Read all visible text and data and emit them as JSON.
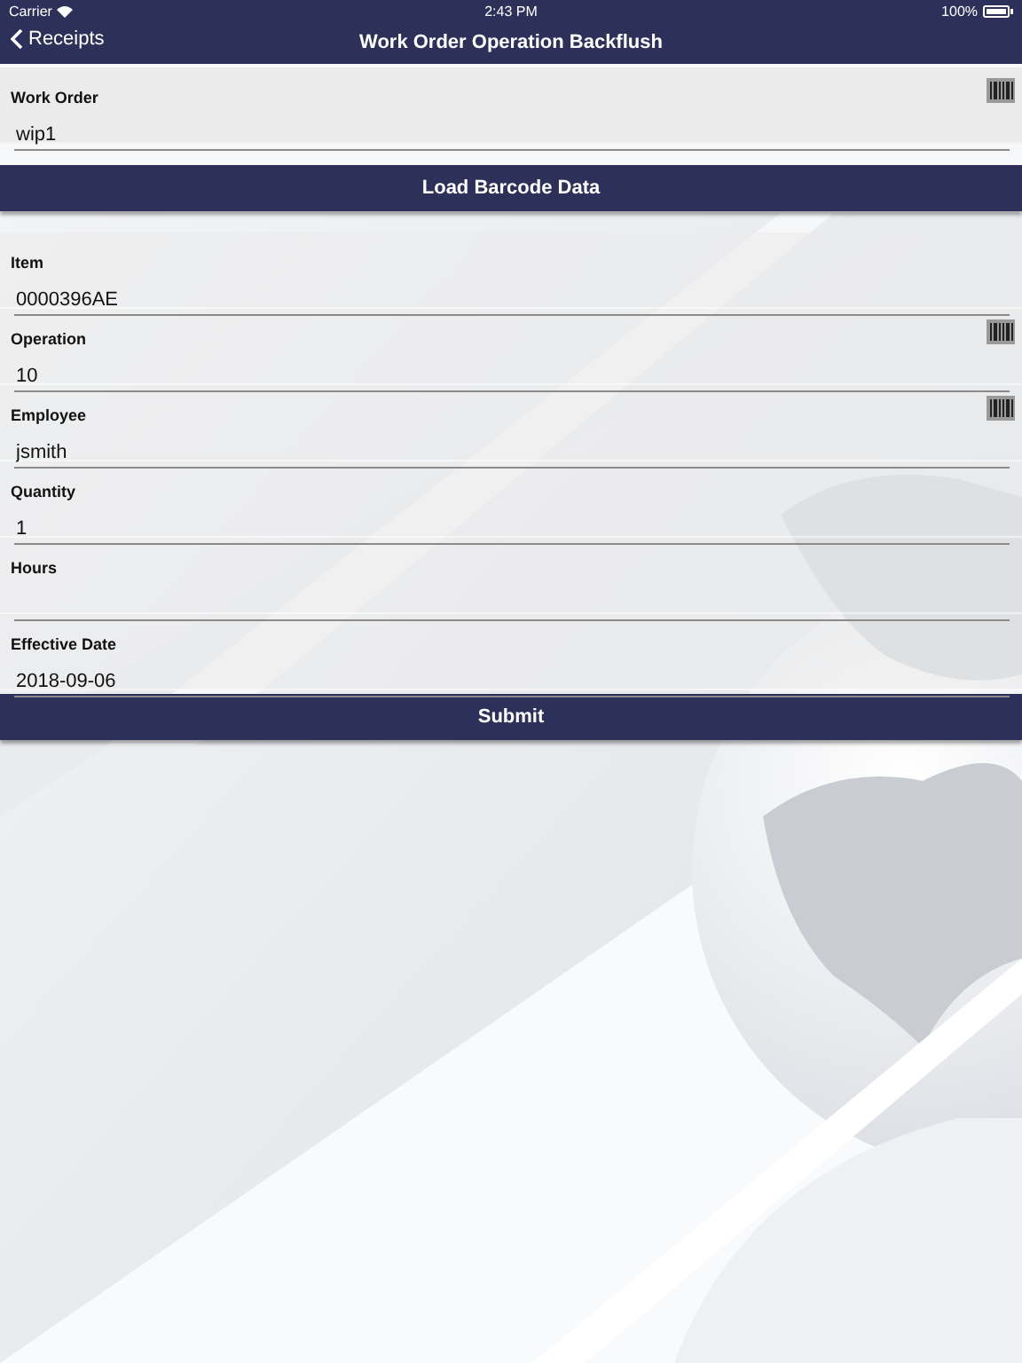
{
  "status_bar": {
    "carrier": "Carrier",
    "time": "2:43 PM",
    "battery": "100%"
  },
  "nav_bar": {
    "back_label": "Receipts",
    "title": "Work Order Operation Backflush"
  },
  "work_order": {
    "label": "Work Order",
    "value": "wip1",
    "scannable": true
  },
  "load_button": "Load Barcode Data",
  "fields": [
    {
      "label": "Item",
      "value": "0000396AE",
      "scannable": false
    },
    {
      "label": "Operation",
      "value": "10",
      "scannable": true
    },
    {
      "label": "Employee",
      "value": "jsmith",
      "scannable": true
    },
    {
      "label": "Quantity",
      "value": "1",
      "scannable": false
    },
    {
      "label": "Hours",
      "scannable": false
    },
    {
      "label": "Effective Date",
      "value": "2018-09-06",
      "scannable": false
    }
  ],
  "submit_button": "Submit"
}
